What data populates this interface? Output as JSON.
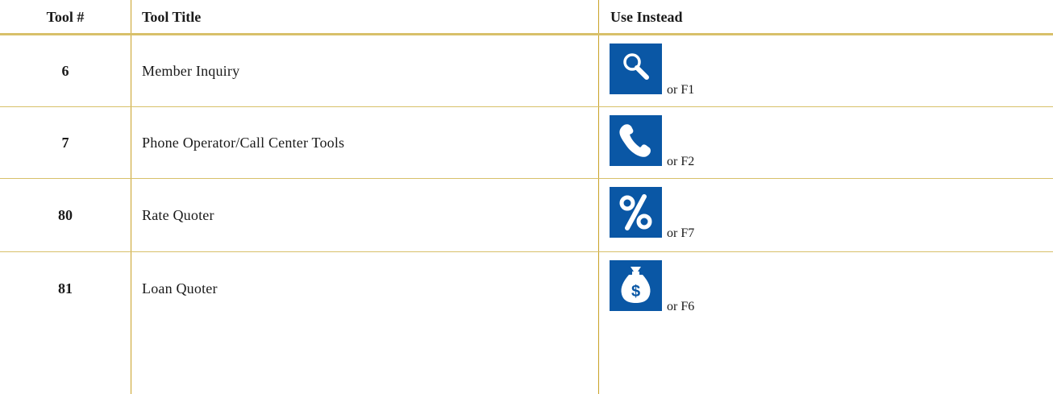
{
  "header": {
    "tool_num": "Tool #",
    "tool_title": "Tool Title",
    "use_instead": "Use Instead"
  },
  "rows": [
    {
      "num": "6",
      "title": "Member Inquiry",
      "icon": "magnifier-icon",
      "key": "or F1"
    },
    {
      "num": "7",
      "title": "Phone Operator/Call Center Tools",
      "icon": "phone-icon",
      "key": "or F2"
    },
    {
      "num": "80",
      "title": "Rate Quoter",
      "icon": "percent-icon",
      "key": "or F7"
    },
    {
      "num": "81",
      "title": "Loan Quoter",
      "icon": "money-bag-icon",
      "key": "or F6"
    }
  ],
  "colors": {
    "rule": "#d8c06a",
    "column_rule": "#c9a227",
    "icon_bg": "#0a57a5",
    "icon_fg": "#ffffff"
  }
}
